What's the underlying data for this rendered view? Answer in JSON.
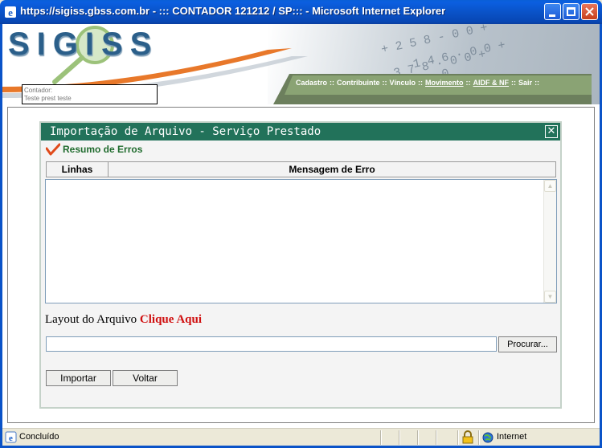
{
  "window": {
    "title": "https://sigiss.gbss.com.br - ::: CONTADOR 121212 / SP::: - Microsoft Internet Explorer"
  },
  "header": {
    "logo_text": "SIGISS",
    "contador_label": "Contador:",
    "contador_value": "Teste prest teste",
    "nav": [
      {
        "label": "Cadastro",
        "underline": false
      },
      {
        "label": "Contribuinte",
        "underline": false
      },
      {
        "label": "Vínculo",
        "underline": false
      },
      {
        "label": "Movimento",
        "underline": true
      },
      {
        "label": "AIDF & NF",
        "underline": true
      },
      {
        "label": "Sair",
        "underline": false
      }
    ],
    "nav_separator": "::"
  },
  "modal": {
    "title": "Importação de Arquivo - Serviço Prestado",
    "close_glyph": "✕",
    "section_title": "Resumo de Erros",
    "table": {
      "columns": [
        "Linhas",
        "Mensagem de Erro"
      ],
      "rows": []
    },
    "layout_text": "Layout do Arquivo",
    "layout_link": "Clique Aqui",
    "file_value": "",
    "browse_label": "Procurar...",
    "import_label": "Importar",
    "back_label": "Voltar"
  },
  "statusbar": {
    "status_text": "Concluído",
    "zone": "Internet"
  },
  "colors": {
    "modal_header": "#22725a",
    "section_title": "#1f6b2d",
    "link": "#d01010",
    "titlebar": "#0a53c8"
  }
}
